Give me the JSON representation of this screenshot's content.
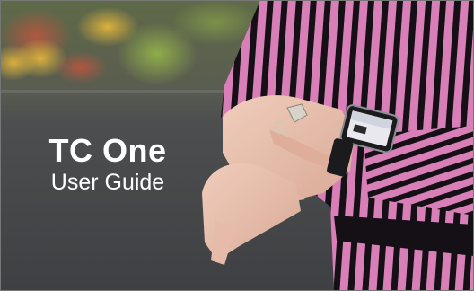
{
  "cover": {
    "title": "TC One",
    "subtitle": "User Guide",
    "colors": {
      "title_text": "#ffffff",
      "stripe_pink": "#d97fb8",
      "stripe_black": "#151015",
      "background_gray": "#4a4a4c"
    }
  }
}
